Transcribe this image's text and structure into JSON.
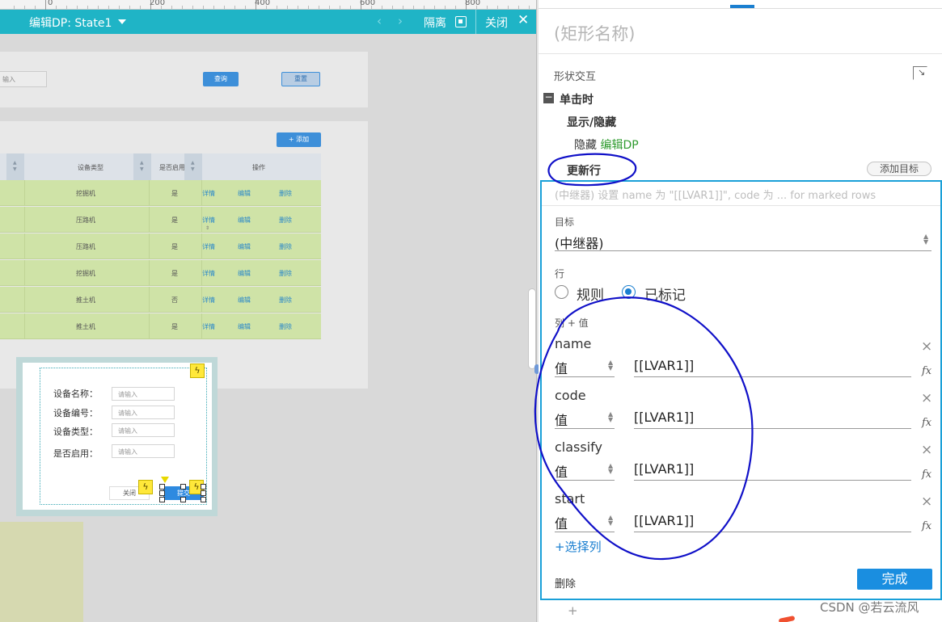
{
  "ruler": {
    "labels": [
      "0",
      "200",
      "400",
      "600",
      "800"
    ]
  },
  "dp_bar": {
    "title": "编辑DP: State1",
    "prev": "‹",
    "next": "›",
    "isolate": "隔离",
    "close": "关闭",
    "x": "✕"
  },
  "canvas": {
    "search_placeholder": "输入",
    "query_btn": "查询",
    "reset_btn": "重置",
    "add_btn": "+ 添加",
    "table_headers": [
      "设备类型",
      "是否启用",
      "操作"
    ],
    "rows": [
      {
        "type": "挖掘机",
        "enabled": "是",
        "detail": "详情",
        "edit": "编辑",
        "delete": "删除"
      },
      {
        "type": "压路机",
        "enabled": "是",
        "detail": "详情",
        "edit": "编辑",
        "delete": "删除"
      },
      {
        "type": "压路机",
        "enabled": "是",
        "detail": "详情",
        "edit": "编辑",
        "delete": "删除"
      },
      {
        "type": "挖掘机",
        "enabled": "是",
        "detail": "详情",
        "edit": "编辑",
        "delete": "删除"
      },
      {
        "type": "推土机",
        "enabled": "否",
        "detail": "详情",
        "edit": "编辑",
        "delete": "删除"
      },
      {
        "type": "推土机",
        "enabled": "是",
        "detail": "详情",
        "edit": "编辑",
        "delete": "删除"
      }
    ],
    "dialog": {
      "fields": [
        {
          "label": "设备名称：",
          "placeholder": "请输入"
        },
        {
          "label": "设备编号：",
          "placeholder": "请输入"
        },
        {
          "label": "设备类型：",
          "placeholder": "请输入"
        },
        {
          "label": "是否启用：",
          "placeholder": "请输入"
        }
      ],
      "close_btn": "关闭",
      "submit_btn": "提交",
      "bolt": "ϟ"
    }
  },
  "panel": {
    "shape_name": "(矩形名称)",
    "interaction_label": "形状交互",
    "collapse": "−",
    "event": "单击时",
    "action_show_hide": "显示/隐藏",
    "hide_prefix": "隐藏",
    "hide_target": "编辑DP",
    "action_update_row": "更新行",
    "add_target": "添加目标",
    "editor": {
      "summary": "(中继器) 设置 name 为 \"[[LVAR1]]\", code 为 ... for marked rows",
      "target_label": "目标",
      "target_value": "(中继器)",
      "row_label": "行",
      "radio_rule": "规则",
      "radio_marked": "已标记",
      "radio_marked_selected": true,
      "col_value_label": "列 + 值",
      "columns": [
        {
          "name": "name",
          "kind": "值",
          "value": "[[LVAR1]]"
        },
        {
          "name": "code",
          "kind": "值",
          "value": "[[LVAR1]]"
        },
        {
          "name": "classify",
          "kind": "值",
          "value": "[[LVAR1]]"
        },
        {
          "name": "start",
          "kind": "值",
          "value": "[[LVAR1]]"
        }
      ],
      "remove_icon": "×",
      "fx_icon": "fx",
      "choose_column": "+选择列",
      "delete": "删除",
      "done": "完成"
    },
    "plus": "+",
    "watermark": "CSDN @若云流风"
  },
  "colors": {
    "dp_bar": "#1fb4c6",
    "accent": "#1a7fd0",
    "editor_border": "#1aa0d8",
    "target_green": "#2e9b2e",
    "row_green": "#cfe3a7",
    "annotation": "#1010c8"
  }
}
